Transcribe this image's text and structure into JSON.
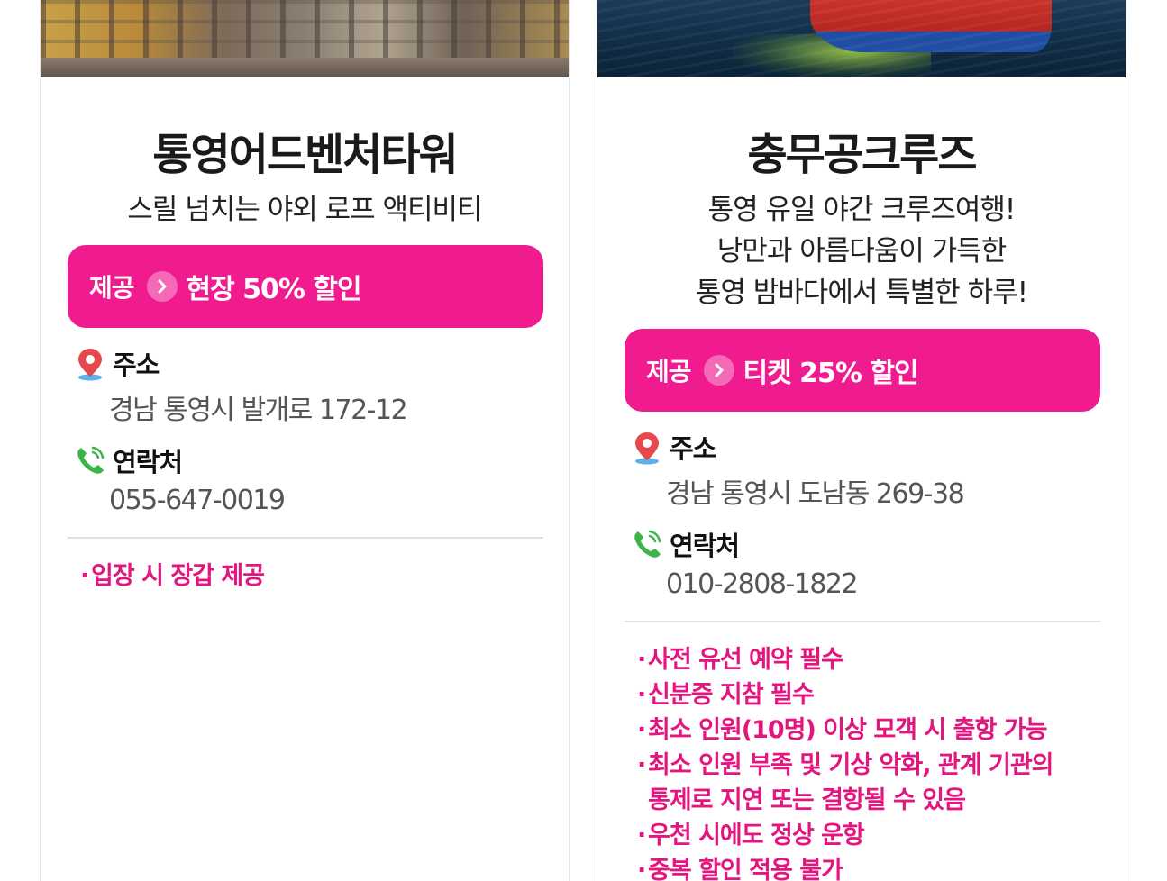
{
  "cards": [
    {
      "title": "통영어드벤처타워",
      "subtitle": [
        "스릴 넘치는 야외 로프 액티비티"
      ],
      "offer": {
        "label": "제공",
        "text": "현장 50% 할인"
      },
      "address": {
        "label": "주소",
        "value": "경남 통영시 발개로 172-12"
      },
      "contact": {
        "label": "연락처",
        "value": "055-647-0019"
      },
      "notes": [
        "입장 시 장갑 제공"
      ]
    },
    {
      "title": "충무공크루즈",
      "subtitle": [
        "통영 유일 야간 크루즈여행!",
        "낭만과 아름다움이 가득한",
        "통영 밤바다에서 특별한 하루!"
      ],
      "offer": {
        "label": "제공",
        "text": "티켓 25% 할인"
      },
      "address": {
        "label": "주소",
        "value": "경남 통영시 도남동 269-38"
      },
      "contact": {
        "label": "연락처",
        "value": "010-2808-1822"
      },
      "notes": [
        "사전 유선 예약 필수",
        "신분증 지참 필수",
        "최소 인원(10명) 이상 모객 시 출항 가능",
        "최소 인원 부족 및 기상 악화, 관계 기관의",
        "통제로 지연 또는 결항될 수 있음",
        "우천 시에도 정상 운항",
        "중복 할인 적용 불가"
      ]
    }
  ],
  "colors": {
    "accent": "#ef1b8f",
    "note_text": "#e4157f",
    "pin": "#e5484d",
    "phone": "#3bb54a"
  },
  "icons": [
    "location-pin-icon",
    "phone-icon",
    "chevron-right-icon"
  ]
}
